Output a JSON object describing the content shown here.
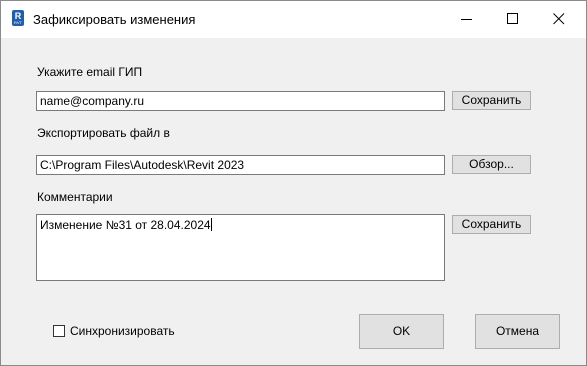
{
  "window": {
    "title": "Зафиксировать изменения",
    "icon": "revit-app-icon",
    "icon_letter": "R",
    "icon_sub": "RVT"
  },
  "email": {
    "label": "Укажите email ГИП",
    "value": "name@company.ru",
    "button_label": "Сохранить"
  },
  "export": {
    "label": "Экспортировать файл в",
    "value": "C:\\Program Files\\Autodesk\\Revit 2023",
    "button_label": "Обзор..."
  },
  "comments": {
    "label": "Комментарии",
    "value": "Изменение №31 от 28.04.2024",
    "button_label": "Сохранить"
  },
  "sync": {
    "label": "Синхронизировать",
    "checked": false
  },
  "footer": {
    "ok_label": "OK",
    "cancel_label": "Отмена"
  }
}
